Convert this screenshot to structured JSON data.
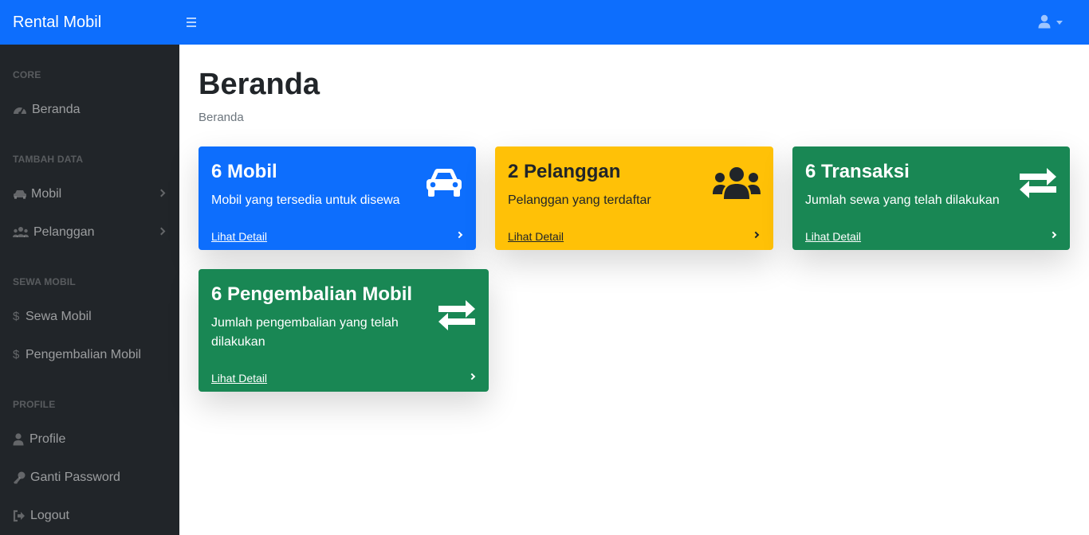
{
  "navbar": {
    "brand": "Rental Mobil",
    "menu_icon": "bars-icon",
    "user_icon": "user-icon",
    "dropdown_icon": "caret-down-icon"
  },
  "sidebar": {
    "sections": [
      {
        "heading": "CORE",
        "items": [
          {
            "label": "Beranda",
            "icon": "tachometer-icon"
          }
        ]
      },
      {
        "heading": "TAMBAH DATA",
        "items": [
          {
            "label": "Mobil",
            "icon": "car-icon",
            "has_submenu": true
          },
          {
            "label": "Pelanggan",
            "icon": "users-icon",
            "has_submenu": true
          }
        ]
      },
      {
        "heading": "SEWA MOBIL",
        "items": [
          {
            "label": "Sewa Mobil",
            "icon": "dollar-icon",
            "glyph": "$"
          },
          {
            "label": "Pengembalian Mobil",
            "icon": "dollar-icon",
            "glyph": "$"
          }
        ]
      },
      {
        "heading": "PROFILE",
        "items": [
          {
            "label": "Profile",
            "icon": "user-icon"
          },
          {
            "label": "Ganti Password",
            "icon": "key-icon"
          },
          {
            "label": "Logout",
            "icon": "sign-out-icon"
          }
        ]
      }
    ]
  },
  "main": {
    "title": "Beranda",
    "breadcrumb": "Beranda",
    "cards": [
      {
        "title": "6 Mobil",
        "description": "Mobil yang tersedia untuk disewa",
        "link": "Lihat Detail",
        "icon": "car-icon",
        "color": "#0d6efd"
      },
      {
        "title": "2 Pelanggan",
        "description": "Pelanggan yang terdaftar",
        "link": "Lihat Detail",
        "icon": "users-icon",
        "color": "#ffc107"
      },
      {
        "title": "6 Transaksi",
        "description": "Jumlah sewa yang telah dilakukan",
        "link": "Lihat Detail",
        "icon": "exchange-icon",
        "color": "#198754"
      },
      {
        "title": "6 Pengembalian Mobil",
        "description": "Jumlah pengembalian yang telah dilakukan",
        "link": "Lihat Detail",
        "icon": "exchange-icon",
        "color": "#198754"
      }
    ]
  }
}
